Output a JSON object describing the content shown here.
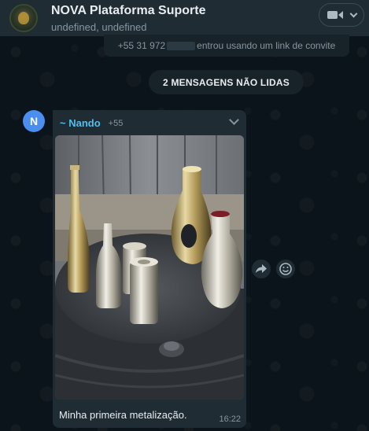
{
  "header": {
    "title": "NOVA Plataforma Suporte",
    "subtitle": "undefined, undefined",
    "video_icon": "video-camera-icon",
    "dropdown_icon": "chevron-down-icon"
  },
  "system_message": {
    "prefix": "+55 31 972",
    "suffix": "entrou usando um link de convite"
  },
  "unread_banner": "2 MENSAGENS NÃO LIDAS",
  "message": {
    "avatar_initial": "N",
    "sender_name": "~ Nando",
    "sender_phone": "+55",
    "caption": "Minha primeira metalização.",
    "time": "16:22"
  },
  "colors": {
    "background": "#0b141a",
    "header": "#202c33",
    "bubble": "#202c33",
    "sender_name": "#53bdeb",
    "avatar": "#4a8ef0"
  },
  "icons": {
    "forward": "forward-arrow-icon",
    "emoji": "emoji-smile-icon"
  }
}
